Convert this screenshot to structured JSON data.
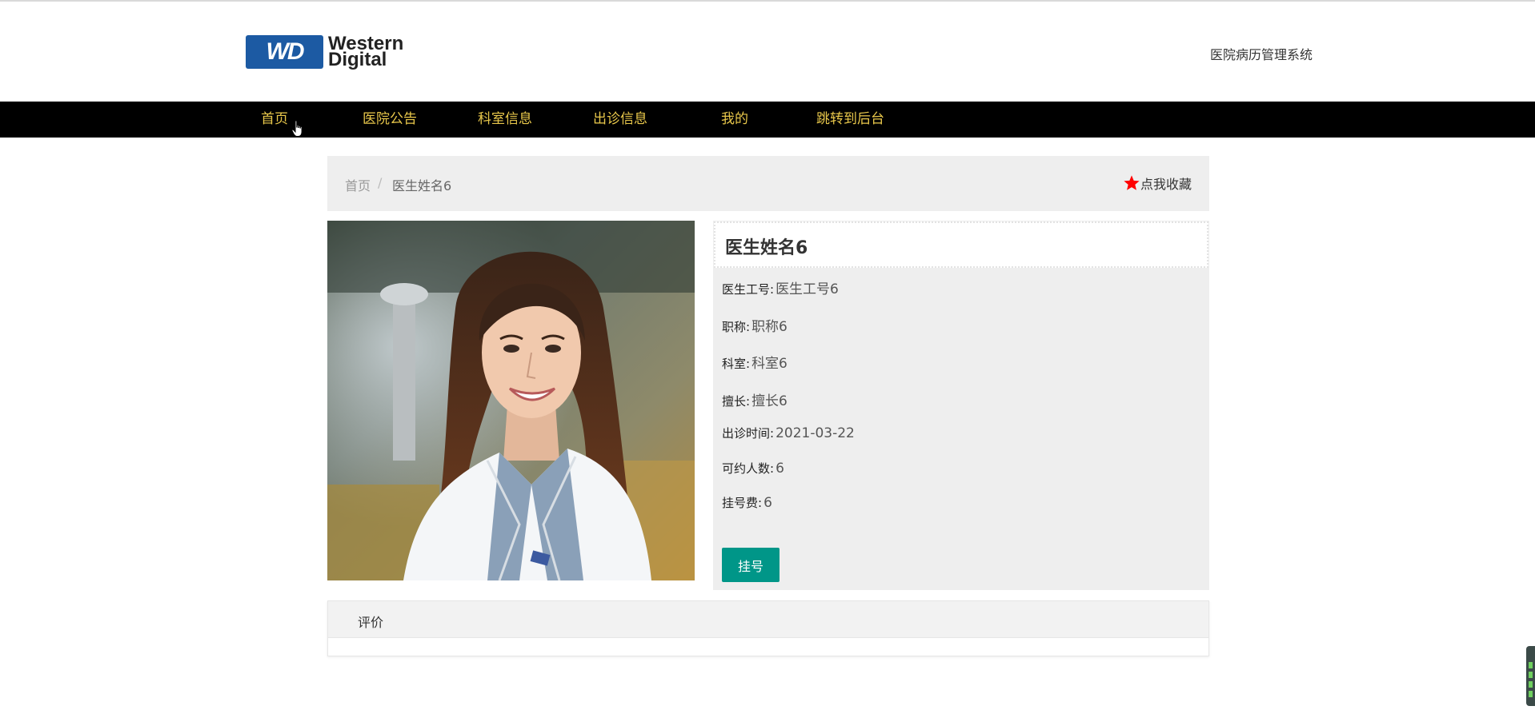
{
  "header": {
    "logo": {
      "badge_text": "WD",
      "line1": "Western",
      "line2": "Digital"
    },
    "site_title": "医院病历管理系统"
  },
  "nav": {
    "items": [
      {
        "label": "首页"
      },
      {
        "label": "医院公告"
      },
      {
        "label": "科室信息"
      },
      {
        "label": "出诊信息"
      },
      {
        "label": "我的"
      },
      {
        "label": "跳转到后台"
      }
    ],
    "text_color": "#e9c84b",
    "background": "#000000"
  },
  "breadcrumb": {
    "home": "首页",
    "separator": "/",
    "current": "医生姓名6",
    "favorite_label": "点我收藏",
    "favorite_icon": "star-icon",
    "favorite_icon_color": "#ff0000"
  },
  "doctor": {
    "photo_alt": "doctor-photo",
    "name": "医生姓名6",
    "fields": [
      {
        "label": "医生工号:",
        "value": "医生工号6"
      },
      {
        "label": "职称:",
        "value": "职称6"
      },
      {
        "label": "科室:",
        "value": "科室6"
      },
      {
        "label": "擅长:",
        "value": "擅长6"
      },
      {
        "label": "出诊时间:",
        "value": "2021-03-22"
      },
      {
        "label": "可约人数:",
        "value": "6"
      },
      {
        "label": "挂号费:",
        "value": "6"
      }
    ],
    "book_button": "挂号",
    "book_button_color": "#009688"
  },
  "reviews": {
    "tab_label": "评价"
  }
}
